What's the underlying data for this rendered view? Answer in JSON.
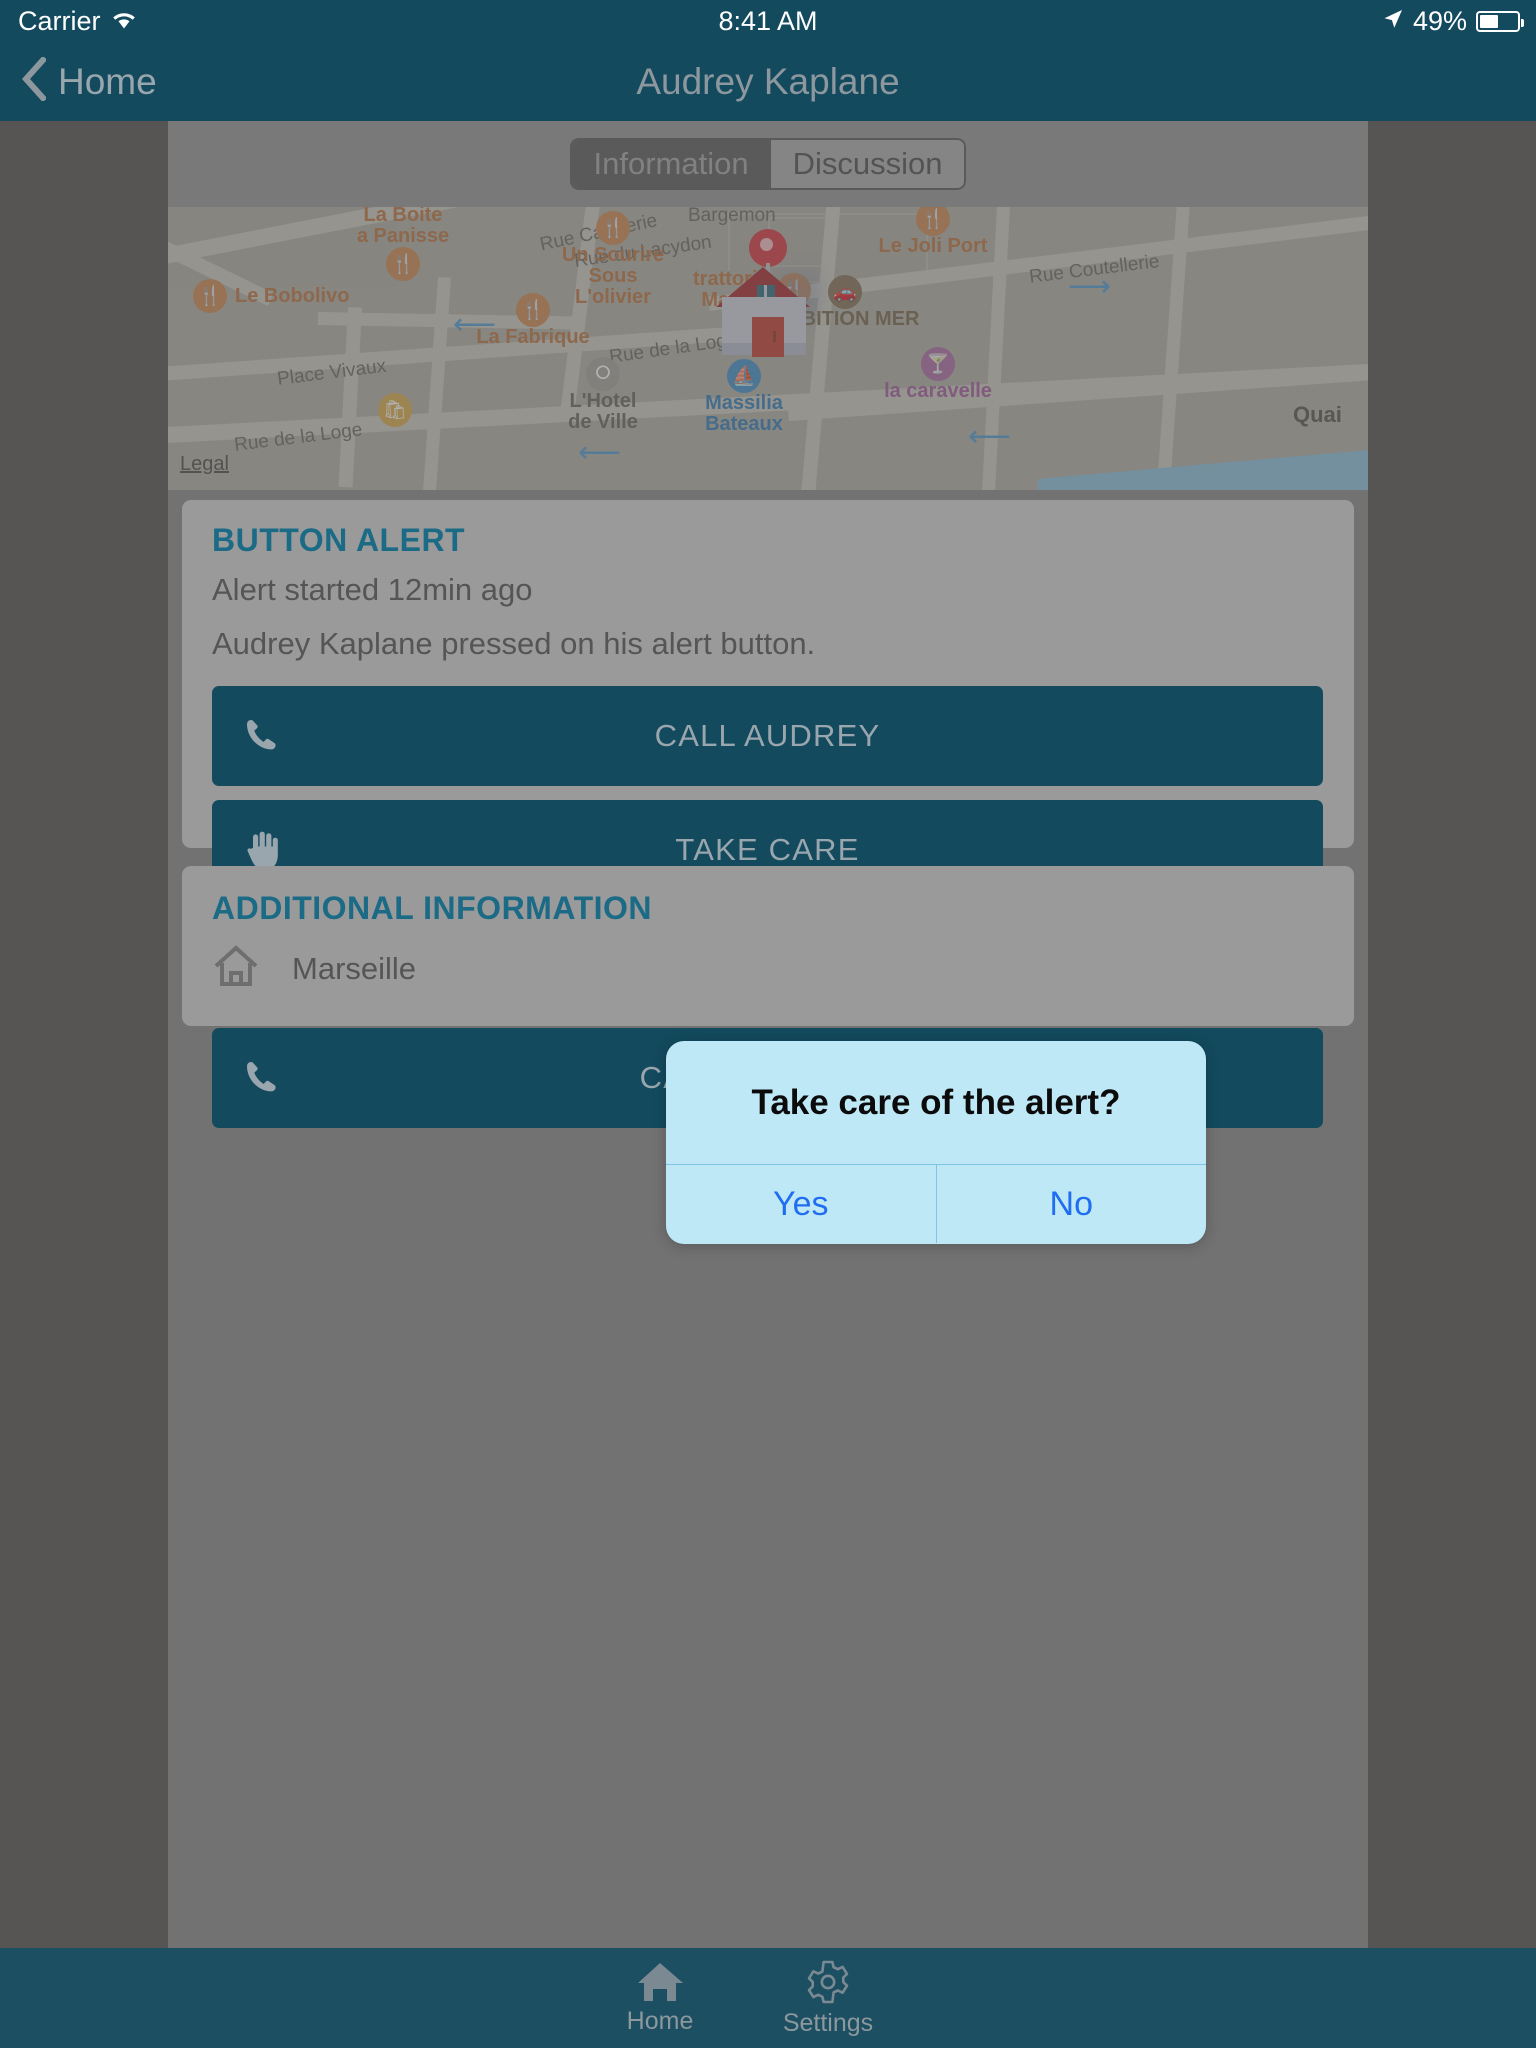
{
  "status_bar": {
    "carrier": "Carrier",
    "wifi_icon": "wifi-icon",
    "time": "8:41 AM",
    "location_icon": "location-arrow-icon",
    "battery_percent": "49%",
    "battery_level": 49
  },
  "nav_bar": {
    "back_icon": "chevron-left-icon",
    "back_label": "Home",
    "title": "Audrey Kaplane"
  },
  "segmented_control": {
    "segments": [
      {
        "label": "Information",
        "selected": true
      },
      {
        "label": "Discussion",
        "selected": false
      }
    ]
  },
  "map": {
    "legal_label": "Legal",
    "marker_icon": "home-pin-marker",
    "pois": [
      {
        "name": "La Boite\na Panisse",
        "icon": "restaurant-icon",
        "kind": "food"
      },
      {
        "name": "Le Bobolivo",
        "icon": "restaurant-icon",
        "kind": "food"
      },
      {
        "name": "La Fabrique",
        "icon": "restaurant-icon",
        "kind": "food"
      },
      {
        "name": "Un Sourire\nSous\nL'olivier",
        "icon": "restaurant-icon",
        "kind": "food"
      },
      {
        "name": "trattoria\nMarco",
        "icon": "restaurant-icon",
        "kind": "food"
      },
      {
        "name": "Le Joli Port",
        "icon": "restaurant-icon",
        "kind": "food"
      },
      {
        "name": "AMBITION MER",
        "icon": "car-icon",
        "kind": "car"
      },
      {
        "name": "la caravelle",
        "icon": "cocktail-icon",
        "kind": "bar"
      },
      {
        "name": "Massilia\nBateaux",
        "icon": "sailboat-icon",
        "kind": "boat"
      },
      {
        "name": "L'Hotel\nde Ville",
        "icon": "hotel-icon",
        "kind": "hotel"
      }
    ],
    "streets": [
      "Rue Caisserie",
      "Bargemon",
      "Rue du Lacydon",
      "Rue Coutellerie",
      "Place Vivaux",
      "Rue de la Loge",
      "Rue de la Loge",
      "Quai"
    ]
  },
  "alert_card": {
    "title": "BUTTON ALERT",
    "started": "Alert started 12min ago",
    "description": "Audrey Kaplane pressed on his alert button.",
    "buttons": [
      {
        "label": "CALL AUDREY",
        "icon": "phone-icon"
      },
      {
        "label": "TAKE CARE",
        "icon": "raised-hand-icon"
      },
      {
        "label": "",
        "icon": "directions-icon"
      },
      {
        "label": "CALL FOR HELP",
        "icon": "phone-icon"
      }
    ]
  },
  "info_card": {
    "title": "ADDITIONAL INFORMATION",
    "icon": "home-outline-icon",
    "value": "Marseille"
  },
  "dialog": {
    "title": "Take care of the alert?",
    "yes_label": "Yes",
    "no_label": "No"
  },
  "tab_bar": {
    "items": [
      {
        "label": "Home",
        "icon": "home-filled-icon"
      },
      {
        "label": "Settings",
        "icon": "gear-icon"
      }
    ]
  },
  "colors": {
    "navy": "#134a5e",
    "accent_teal": "#1b6a86",
    "dialog_bg": "#bfe8f7",
    "dialog_action": "#1f6df0",
    "tabbar": "#1b4f61"
  }
}
